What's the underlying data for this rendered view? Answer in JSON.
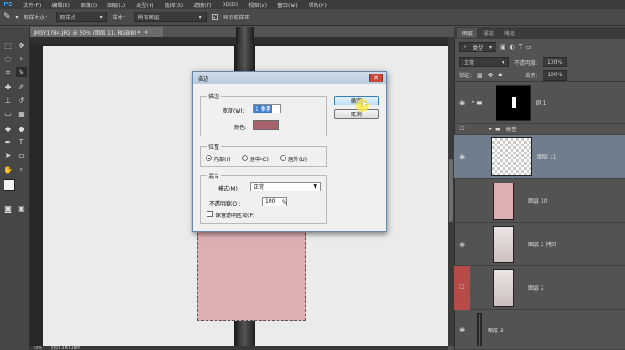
{
  "app": {
    "logo": "PS"
  },
  "menu": [
    "文件(F)",
    "编辑(E)",
    "图像(I)",
    "图层(L)",
    "类型(Y)",
    "选择(S)",
    "滤镜(T)",
    "3D(D)",
    "视图(V)",
    "窗口(W)",
    "帮助(H)"
  ],
  "options": {
    "sample_size_label": "取样大小：",
    "sample_size_value": "取样点",
    "sample_label": "样本：",
    "sample_value": "所有图层",
    "show_ring_label": "显示取样环"
  },
  "document": {
    "tab_title": "JMSY1784.JPG @ 50% (图层 11, RGB/8) *",
    "close": "×"
  },
  "status": {
    "zoom": "50%",
    "doc_info": "文档:1.4M/13.8M"
  },
  "dialog": {
    "title": "描边",
    "close": "✕",
    "stroke_group": "描边",
    "width_label": "宽度(W):",
    "width_value": "1 像素",
    "color_label": "颜色:",
    "color_value": "#a8646c",
    "ok_button": "确定",
    "cancel_button": "取消",
    "position_group": "位置",
    "pos_inside": "内部(I)",
    "pos_center": "居中(C)",
    "pos_outside": "居外(U)",
    "blend_group": "混合",
    "mode_label": "模式(M):",
    "mode_value": "正常",
    "opacity_label": "不透明度(O):",
    "opacity_value": "100",
    "opacity_unit": "%",
    "preserve_label": "保留透明区域(P)"
  },
  "panel": {
    "tabs": [
      "图层",
      "通道",
      "路径"
    ],
    "filter_label": "类型",
    "blend_mode": "正常",
    "opacity_label": "不透明度:",
    "opacity_value": "100%",
    "lock_label": "锁定:",
    "fill_label": "填充:",
    "fill_value": "100%",
    "layers": [
      {
        "name": "组 1",
        "visible": true
      },
      {
        "name": "标签",
        "visible": false
      },
      {
        "name": "图层 11",
        "visible": true
      },
      {
        "name": "图层 10",
        "visible": false
      },
      {
        "name": "图层 2 拷贝",
        "visible": true
      },
      {
        "name": "图层 2",
        "visible": false
      },
      {
        "name": "图层 3",
        "visible": true
      }
    ]
  },
  "colors": {
    "accent": "#31a8ff",
    "selection": "#6f7d8d",
    "stroke_color": "#a8646c",
    "swatch_red": "#b84a4a"
  }
}
